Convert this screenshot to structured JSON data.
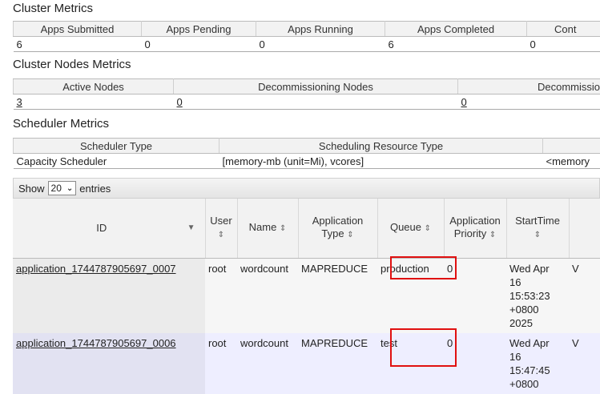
{
  "cluster_metrics": {
    "title": "Cluster Metrics",
    "headers": [
      "Apps Submitted",
      "Apps Pending",
      "Apps Running",
      "Apps Completed",
      "Cont"
    ],
    "values": [
      "6",
      "0",
      "0",
      "6",
      "0"
    ]
  },
  "node_metrics": {
    "title": "Cluster Nodes Metrics",
    "headers": [
      "Active Nodes",
      "Decommissioning Nodes",
      "Decommissio"
    ],
    "values": [
      "3",
      "0",
      "0"
    ]
  },
  "scheduler_metrics": {
    "title": "Scheduler Metrics",
    "headers": [
      "Scheduler Type",
      "Scheduling Resource Type",
      ""
    ],
    "values": [
      "Capacity Scheduler",
      "[memory-mb (unit=Mi), vcores]",
      "<memory"
    ]
  },
  "show": {
    "prefix": "Show",
    "value": "20",
    "suffix": "entries"
  },
  "apps_table": {
    "headers": {
      "id": "ID",
      "user": "User",
      "name": "Name",
      "app_type_1": "Application",
      "app_type_2": "Type",
      "queue": "Queue",
      "priority_1": "Application",
      "priority_2": "Priority",
      "start": "StartTime"
    },
    "rows": [
      {
        "id": "application_1744787905697_0007",
        "user": "root",
        "name": "wordcount",
        "type": "MAPREDUCE",
        "queue": "production",
        "priority": "0",
        "start": [
          "Wed Apr",
          "16",
          "15:53:23",
          "+0800",
          "2025"
        ],
        "extra": "V"
      },
      {
        "id": "application_1744787905697_0006",
        "user": "root",
        "name": "wordcount",
        "type": "MAPREDUCE",
        "queue": "test",
        "priority": "0",
        "start": [
          "Wed Apr",
          "16",
          "15:47:45",
          "+0800"
        ],
        "extra": "V"
      }
    ]
  },
  "colors": {
    "highlight": "#e01010",
    "header_bg": "#f2f2f2",
    "row_alt": "#eeeeff"
  }
}
